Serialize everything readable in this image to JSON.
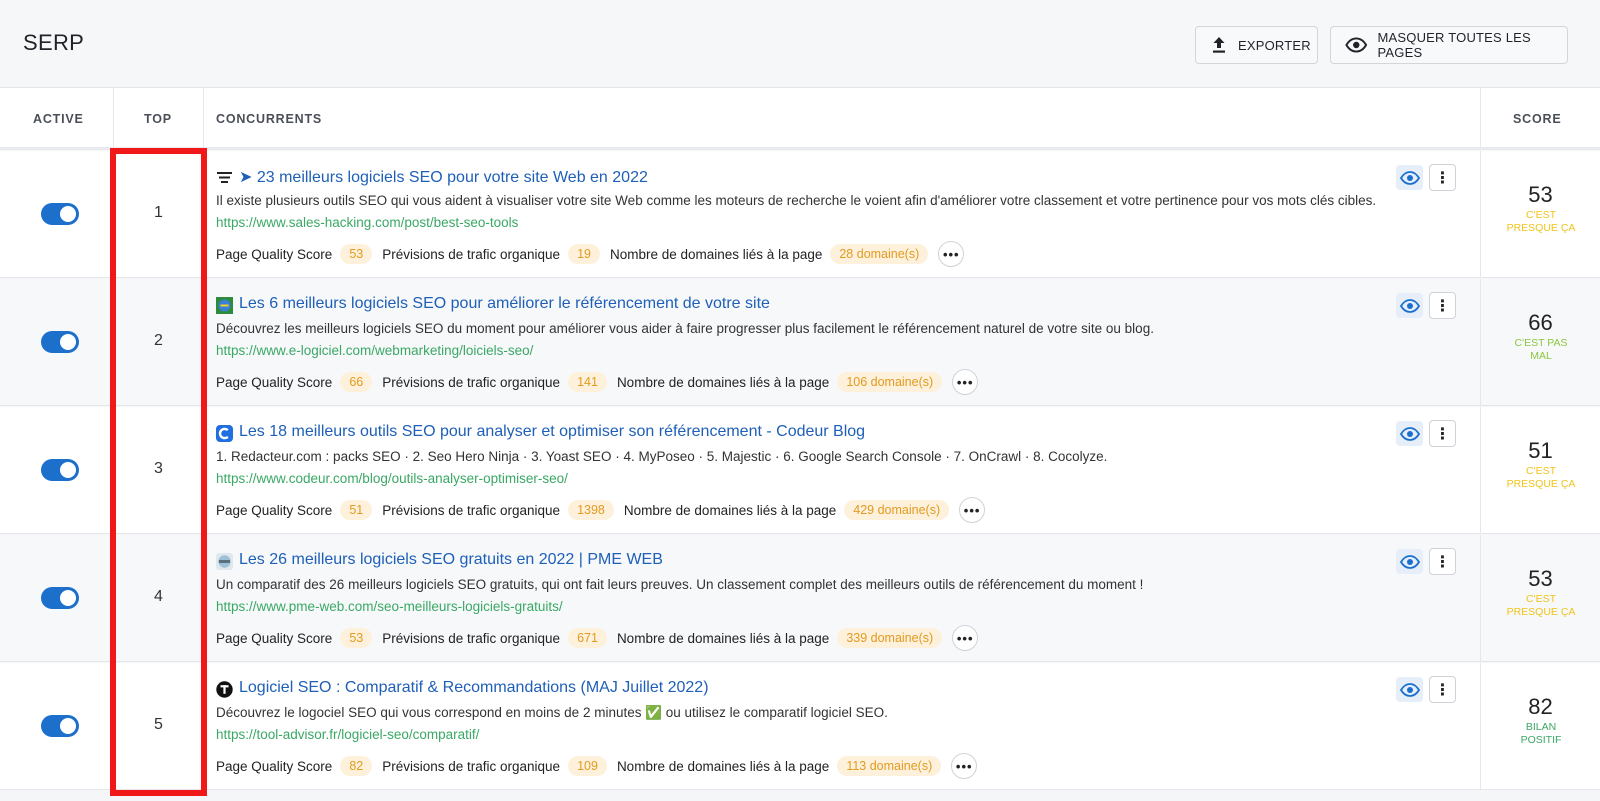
{
  "header": {
    "title": "SERP",
    "export_label": "EXPORTER",
    "hide_label": "MASQUER TOUTES LES PAGES"
  },
  "columns": {
    "active": "ACTIVE",
    "top": "TOP",
    "competitors": "CONCURRENTS",
    "score": "SCORE"
  },
  "metric_labels": {
    "quality": "Page Quality Score",
    "traffic": "Prévisions de trafic organique",
    "domains": "Nombre de domaines liés à la page"
  },
  "colors": {
    "accent": "#1d6fcc",
    "link": "#1e5fb8",
    "url": "#3aa865",
    "pill_text": "#e39a1f",
    "pill_bg": "#fdf1dc",
    "score_yellow": "#f0c419",
    "score_light_green": "#8cc63f",
    "score_green": "#3aa865",
    "highlight": "#f01818"
  },
  "rows": [
    {
      "rank": "1",
      "active": true,
      "favicon": "sales-hacking-favicon",
      "title": "➤ 23 meilleurs logiciels SEO pour votre site Web en 2022",
      "description": "Il existe plusieurs outils SEO qui vous aident à visualiser votre site Web comme les moteurs de recherche le voient afin d'améliorer votre classement et votre pertinence pour vos mots clés cibles.",
      "url": "https://www.sales-hacking.com/post/best-seo-tools",
      "quality": "53",
      "traffic": "19",
      "domains": "28 domaine(s)",
      "score": "53",
      "score_label": "C'EST PRESQUE ÇA",
      "score_color": "#f0c419"
    },
    {
      "rank": "2",
      "active": true,
      "favicon": "e-logiciel-favicon",
      "title": "Les 6 meilleurs logiciels SEO pour améliorer le référencement de votre site",
      "description": "Découvrez les meilleurs logiciels SEO du moment pour améliorer vous aider à faire progresser plus facilement le référencement naturel de votre site ou blog.",
      "url": "https://www.e-logiciel.com/webmarketing/loiciels-seo/",
      "quality": "66",
      "traffic": "141",
      "domains": "106 domaine(s)",
      "score": "66",
      "score_label": "C'EST PAS MAL",
      "score_color": "#8cc63f"
    },
    {
      "rank": "3",
      "active": true,
      "favicon": "codeur-favicon",
      "title": "Les 18 meilleurs outils SEO pour analyser et optimiser son référencement - Codeur Blog",
      "description": "1. Redacteur.com : packs SEO · 2. Seo Hero Ninja · 3. Yoast SEO · 4. MyPoseo · 5. Majestic · 6. Google Search Console · 7. OnCrawl · 8. Cocolyze.",
      "url": "https://www.codeur.com/blog/outils-analyser-optimiser-seo/",
      "quality": "51",
      "traffic": "1398",
      "domains": "429 domaine(s)",
      "score": "51",
      "score_label": "C'EST PRESQUE ÇA",
      "score_color": "#f0c419"
    },
    {
      "rank": "4",
      "active": true,
      "favicon": "pme-web-favicon",
      "title": "Les 26 meilleurs logiciels SEO gratuits en 2022 | PME WEB",
      "description": "Un comparatif des 26 meilleurs logiciels SEO gratuits, qui ont fait leurs preuves. Un classement complet des meilleurs outils de référencement du moment !",
      "url": "https://www.pme-web.com/seo-meilleurs-logiciels-gratuits/",
      "quality": "53",
      "traffic": "671",
      "domains": "339 domaine(s)",
      "score": "53",
      "score_label": "C'EST PRESQUE ÇA",
      "score_color": "#f0c419"
    },
    {
      "rank": "5",
      "active": true,
      "favicon": "tool-advisor-favicon",
      "title": "Logiciel SEO : Comparatif & Recommandations (MAJ Juillet 2022)",
      "description": "Découvrez le logociel SEO qui vous correspond en moins de 2 minutes ✅ ou utilisez le comparatif logiciel SEO.",
      "url": "https://tool-advisor.fr/logiciel-seo/comparatif/",
      "quality": "82",
      "traffic": "109",
      "domains": "113 domaine(s)",
      "score": "82",
      "score_label": "BILAN POSITIF",
      "score_color": "#3aa865"
    }
  ]
}
